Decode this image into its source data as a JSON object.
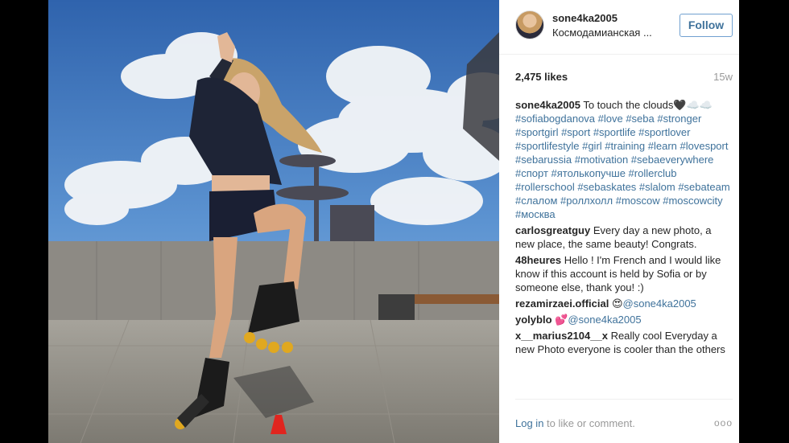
{
  "post": {
    "username": "sone4ka2005",
    "location": "Космодамианская ...",
    "follow_label": "Follow",
    "likes": "2,475 likes",
    "age": "15w"
  },
  "caption": {
    "user": "sone4ka2005",
    "text": "To touch the clouds🖤☁️☁️",
    "tags": "#sofiabogdanova #love #seba #stronger #sportgirl #sport #sportlife #sportlover #sportlifestyle #girl #training #learn #lovesport #sebarussia #motivation #sebaeverywhere #спорт #ятолькопучше #rollerclub #rollerschool #sebaskates #slalom #sebateam #слалом #роллхолл #moscow #moscowcity #москва"
  },
  "comments": [
    {
      "user": "carlosgreatguy",
      "text": "Every day a new photo, a new place, the same beauty! Congrats.",
      "mention": ""
    },
    {
      "user": "48heures",
      "text": "Hello ! I'm French and I would like know if this account is held by Sofia or by someone else, thank you! :)",
      "mention": ""
    },
    {
      "user": "rezamirzaei.official",
      "text": "😍",
      "mention": "@sone4ka2005"
    },
    {
      "user": "yolyblo",
      "text": "💕",
      "mention": "@sone4ka2005"
    },
    {
      "user": "x__marius2104__x",
      "text": "Really cool Everyday a new Photo everyone is cooler than the others",
      "mention": ""
    }
  ],
  "footer": {
    "login_label": "Log in",
    "login_suffix": " to like or comment.",
    "more_icon": "ooo"
  },
  "colors": {
    "link": "#3f729b",
    "muted": "#999999",
    "text": "#262626"
  },
  "icons": {
    "more": "more-options-icon",
    "avatar": "user-avatar"
  }
}
